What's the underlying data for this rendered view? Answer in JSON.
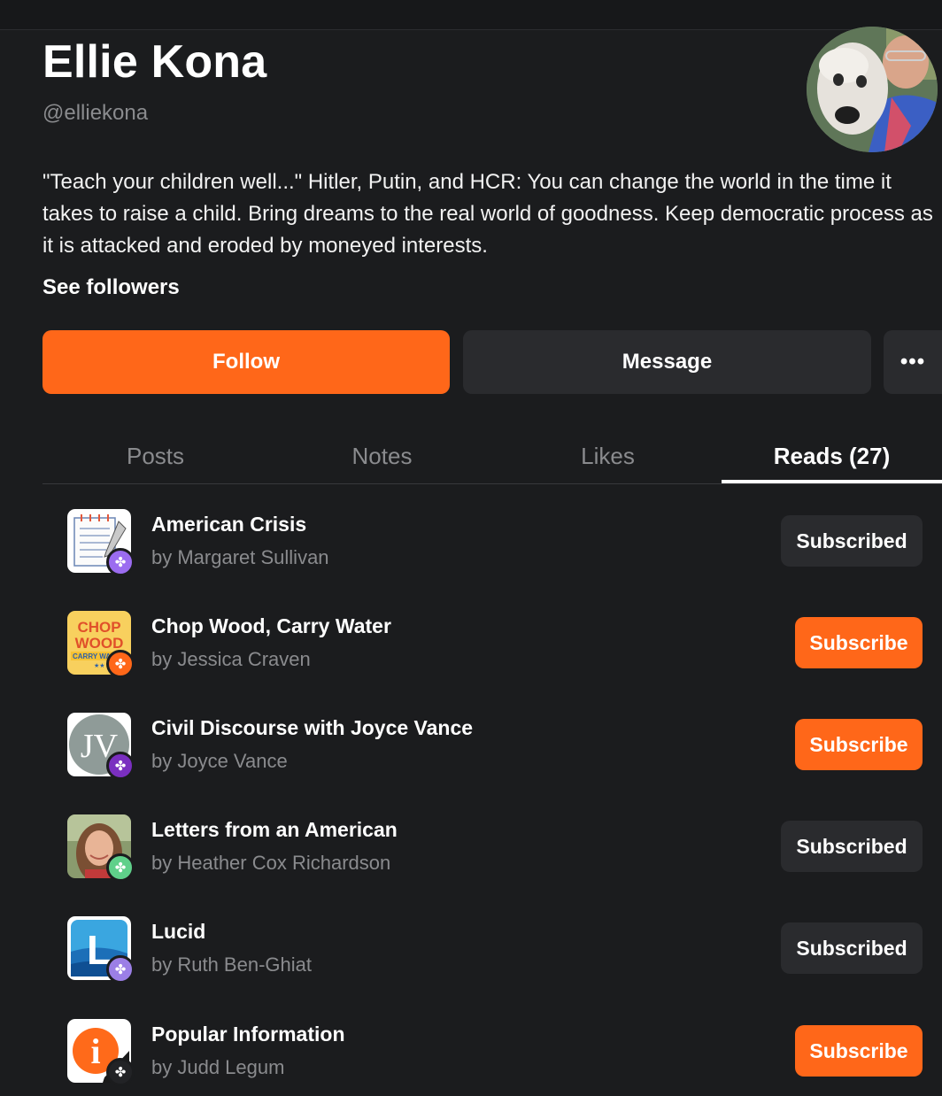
{
  "profile": {
    "name": "Ellie Kona",
    "handle": "@elliekona",
    "bio": "\"Teach your children well...\" Hitler, Putin, and HCR: You can change the world in the time it takes to raise a child. Bring dreams to the real world of goodness. Keep democratic process as it is attacked and eroded by moneyed interests.",
    "see_followers": "See followers"
  },
  "actions": {
    "follow": "Follow",
    "message": "Message",
    "more": "•••"
  },
  "tabs": [
    {
      "label": "Posts",
      "active": false
    },
    {
      "label": "Notes",
      "active": false
    },
    {
      "label": "Likes",
      "active": false
    },
    {
      "label": "Reads (27)",
      "active": true
    }
  ],
  "reads": [
    {
      "title": "American Crisis",
      "author": "by Margaret Sullivan",
      "button": "Subscribed",
      "subscribed": true,
      "icon": "notepad-icon",
      "badge_color": "#9b6cf0"
    },
    {
      "title": "Chop Wood, Carry Water",
      "author": "by Jessica Craven",
      "button": "Subscribe",
      "subscribed": false,
      "icon": "chop-wood-logo",
      "icon_text": [
        "CHOP",
        "WOOD",
        "CARRY WA"
      ],
      "badge_color": "#ff6719"
    },
    {
      "title": "Civil Discourse with Joyce Vance",
      "author": "by Joyce Vance",
      "button": "Subscribe",
      "subscribed": false,
      "icon": "jv-monogram-logo",
      "icon_text": [
        "JV"
      ],
      "badge_color": "#7a2fc0"
    },
    {
      "title": "Letters from an American",
      "author": "by Heather Cox Richardson",
      "button": "Subscribed",
      "subscribed": true,
      "icon": "portrait-photo",
      "badge_color": "#5fd08a"
    },
    {
      "title": "Lucid",
      "author": "by Ruth Ben-Ghiat",
      "button": "Subscribed",
      "subscribed": true,
      "icon": "lucid-logo",
      "icon_text": [
        "L"
      ],
      "badge_color": "#9b7fe6"
    },
    {
      "title": "Popular Information",
      "author": "by Judd Legum",
      "button": "Subscribe",
      "subscribed": false,
      "icon": "info-logo",
      "icon_text": [
        "i"
      ],
      "badge_color": "#222326"
    }
  ],
  "colors": {
    "accent": "#ff6719",
    "background": "#1b1c1e",
    "button_dark": "#2a2b2e",
    "muted_text": "#8a8b8e"
  }
}
